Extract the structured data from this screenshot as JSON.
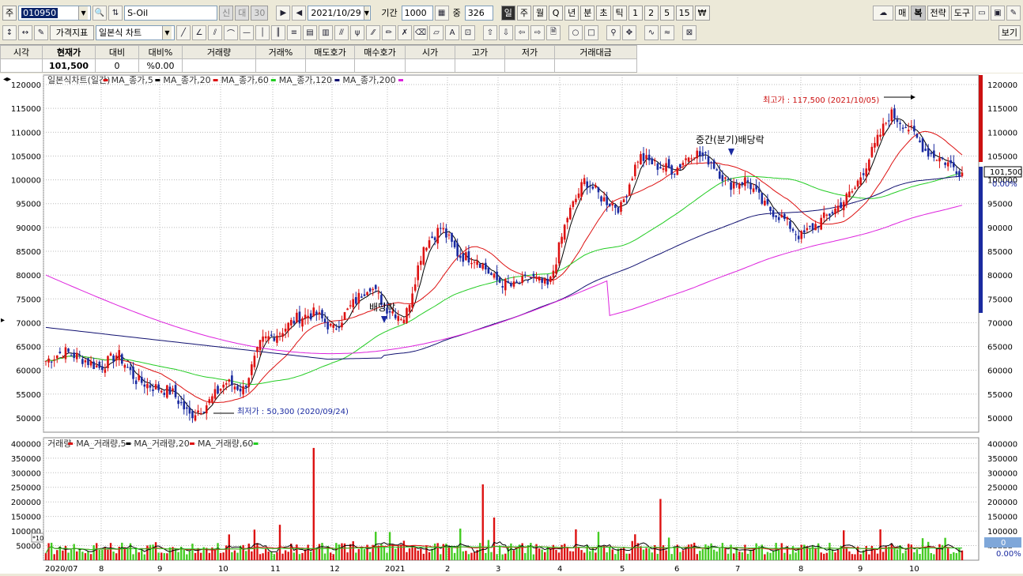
{
  "toolbar": {
    "market_label": "주",
    "code_value": "010950",
    "stock_name": "S-Oil",
    "tags": [
      "신",
      "대",
      "30"
    ],
    "date_value": "2021/10/29",
    "period_label": "기간",
    "period_value": "1000",
    "count_label": "중",
    "count_value": "326",
    "periods": [
      "일",
      "주",
      "월",
      "Q",
      "년",
      "분",
      "초",
      "틱",
      "1",
      "2",
      "5",
      "15",
      "₩"
    ],
    "right_buttons": [
      "매",
      "복",
      "전략",
      "도구"
    ],
    "chart_type_label": "가격지표",
    "chart_style_value": "일본식 차트",
    "view_button": "보기"
  },
  "price_grid": {
    "headers": [
      "시각",
      "현재가",
      "대비",
      "대비%",
      "거래량",
      "거래%",
      "매도호가",
      "매수호가",
      "시가",
      "고가",
      "저가",
      "거래대금"
    ],
    "values": [
      "",
      "101,500",
      "0",
      "%0.00",
      "",
      "",
      "",
      "",
      "",
      "",
      "",
      ""
    ]
  },
  "price_panel": {
    "legend": [
      {
        "label": "일본식차트(일간)",
        "color": "#dd1111"
      },
      {
        "label": "MA_종가,5",
        "color": "#000000"
      },
      {
        "label": "MA_종가,20",
        "color": "#dd1111"
      },
      {
        "label": "MA_종가,60",
        "color": "#22cc22"
      },
      {
        "label": "MA_종가,120",
        "color": "#101070"
      },
      {
        "label": "MA_종가,200",
        "color": "#dd22dd"
      }
    ],
    "y_ticks": [
      "120000",
      "115000",
      "110000",
      "105000",
      "100000",
      "95000",
      "90000",
      "85000",
      "80000",
      "75000",
      "70000",
      "65000",
      "60000",
      "55000",
      "50000"
    ],
    "annotation_high": "최고가 : 117,500 (2021/10/05)",
    "annotation_low": "최저가 : 50,300 (2020/09/24)",
    "annotation_div1": "배당락",
    "annotation_div2": "중간(분기)배당락",
    "current_price": "101,500",
    "current_change": "0.00%"
  },
  "volume_panel": {
    "legend": [
      {
        "label": "거래량",
        "color": "#dd1111"
      },
      {
        "label": "MA_거래량,5",
        "color": "#000000"
      },
      {
        "label": "MA_거래량,20",
        "color": "#dd1111"
      },
      {
        "label": "MA_거래량,60",
        "color": "#22cc22"
      }
    ],
    "y_ticks": [
      "400000",
      "350000",
      "300000",
      "250000",
      "200000",
      "150000",
      "100000",
      "50000"
    ],
    "scale_note": "*10",
    "current_value": "0",
    "current_change": "0.00%"
  },
  "x_ticks": [
    "2020/07",
    "8",
    "9",
    "10",
    "11",
    "12",
    "2021",
    "2",
    "3",
    "4",
    "5",
    "6",
    "7",
    "8",
    "9",
    "10"
  ],
  "chart_data": {
    "type": "candlestick",
    "x_range": [
      "2020/07",
      "2021/10/29"
    ],
    "price_ylim": [
      47000,
      122000
    ],
    "volume_ylim": [
      0,
      420000
    ],
    "monthly_close": [
      {
        "month": "2020/07",
        "value": 62000
      },
      {
        "month": "2020/08",
        "value": 63000
      },
      {
        "month": "2020/09",
        "value": 51500
      },
      {
        "month": "2020/10",
        "value": 57000
      },
      {
        "month": "2020/11",
        "value": 66000
      },
      {
        "month": "2020/12",
        "value": 71000
      },
      {
        "month": "2021/01",
        "value": 74000
      },
      {
        "month": "2021/02",
        "value": 88000
      },
      {
        "month": "2021/03",
        "value": 83000
      },
      {
        "month": "2021/04",
        "value": 78500
      },
      {
        "month": "2021/05",
        "value": 96000
      },
      {
        "month": "2021/06",
        "value": 104000
      },
      {
        "month": "2021/07",
        "value": 105000
      },
      {
        "month": "2021/08",
        "value": 92000
      },
      {
        "month": "2021/09",
        "value": 104000
      },
      {
        "month": "2021/10",
        "value": 101500
      }
    ],
    "high": {
      "date": "2021/10/05",
      "value": 117500
    },
    "low": {
      "date": "2020/09/24",
      "value": 50300
    },
    "moving_averages": [
      "MA_종가,5",
      "MA_종가,20",
      "MA_종가,60",
      "MA_종가,120",
      "MA_종가,200"
    ],
    "volume_peaks": [
      {
        "month": "2020/11",
        "value": 385000
      },
      {
        "month": "2021/02",
        "value": 260000
      },
      {
        "month": "2021/05",
        "value": 210000
      }
    ]
  }
}
